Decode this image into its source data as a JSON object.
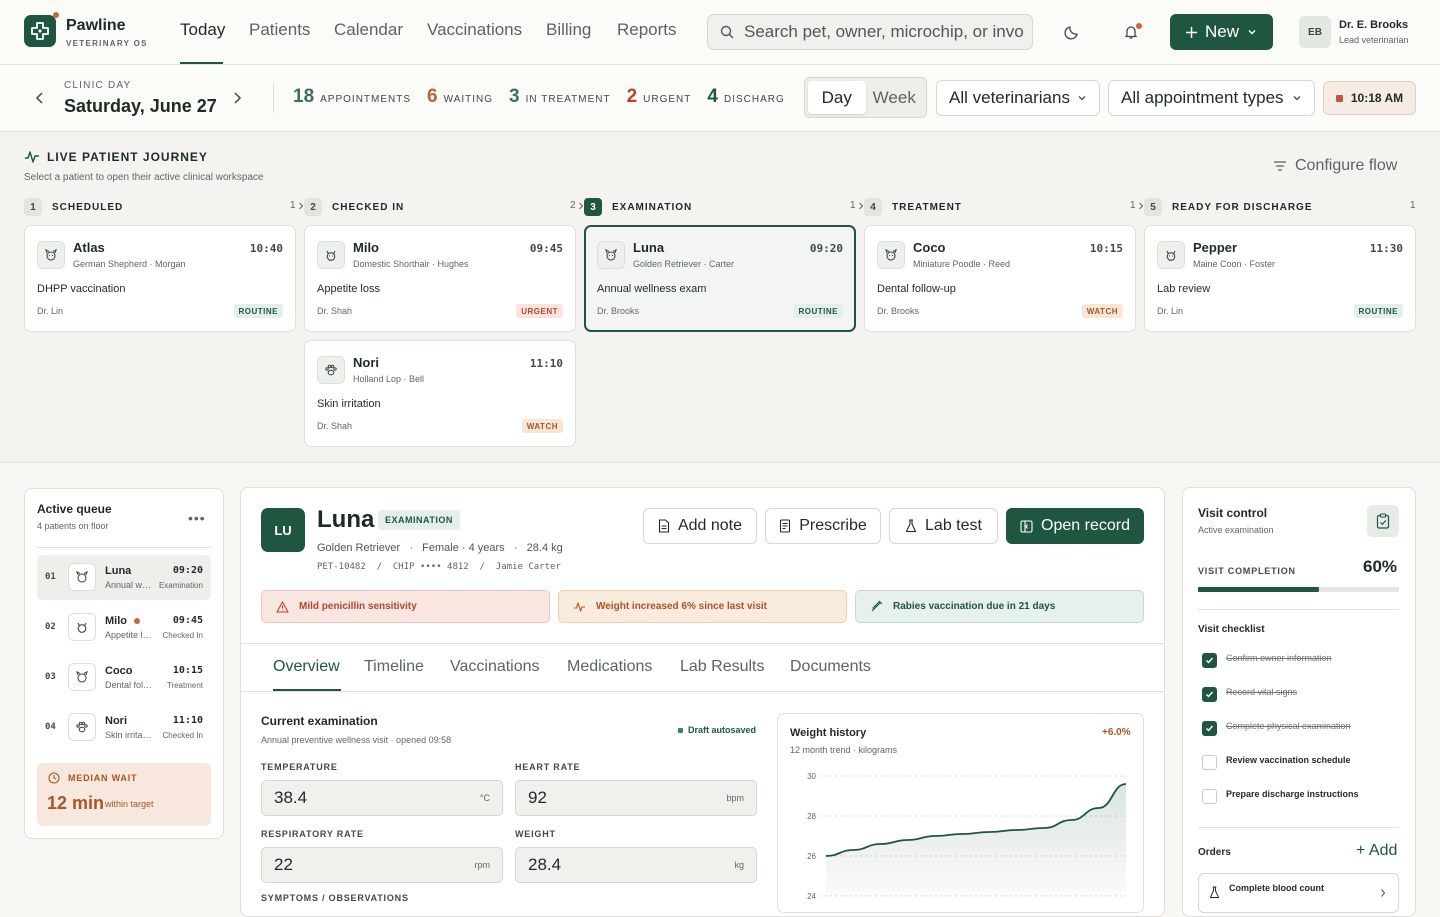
{
  "brand": {
    "name": "Pawline",
    "sub": "VETERINARY OS"
  },
  "nav": [
    {
      "label": "Today"
    },
    {
      "label": "Patients"
    },
    {
      "label": "Calendar"
    },
    {
      "label": "Vaccinations"
    },
    {
      "label": "Billing"
    },
    {
      "label": "Reports"
    }
  ],
  "search": {
    "placeholder": "Search pet, owner, microchip, or invoice"
  },
  "new_button": "New",
  "user": {
    "initials": "EB",
    "name": "Dr. E. Brooks",
    "role": "Lead veterinarian"
  },
  "clinic_day": {
    "label": "CLINIC DAY",
    "date": "Saturday, June 27"
  },
  "stats": [
    {
      "num": "18",
      "label": "APPOINTMENTS",
      "color": "#3f6e5c"
    },
    {
      "num": "6",
      "label": "WAITING",
      "color": "#b9613d"
    },
    {
      "num": "3",
      "label": "IN TREATMENT",
      "color": "#3f6e5c"
    },
    {
      "num": "2",
      "label": "URGENT",
      "color": "#b6452e"
    },
    {
      "num": "4",
      "label": "DISCHARGED",
      "color": "#1f5640"
    }
  ],
  "view_toggle": {
    "day": "Day",
    "week": "Week"
  },
  "filters": {
    "vets": "All veterinarians",
    "types": "All appointment types"
  },
  "clock": "10:18 AM",
  "journey": {
    "title": "LIVE PATIENT JOURNEY",
    "subtitle": "Select a patient to open their active clinical workspace",
    "configure": "Configure flow"
  },
  "columns": [
    {
      "num": "1",
      "name": "SCHEDULED",
      "count": "1"
    },
    {
      "num": "2",
      "name": "CHECKED IN",
      "count": "2"
    },
    {
      "num": "3",
      "name": "EXAMINATION",
      "count": "1"
    },
    {
      "num": "4",
      "name": "TREATMENT",
      "count": "1"
    },
    {
      "num": "5",
      "name": "READY FOR DISCHARGE",
      "count": "1"
    }
  ],
  "cards": [
    {
      "name": "Atlas",
      "breed": "German Shepherd · Morgan",
      "time": "10:40",
      "reason": "DHPP vaccination",
      "vet": "Dr. Lin",
      "badge": "ROUTINE",
      "icon": "dog-icon"
    },
    {
      "name": "Milo",
      "breed": "Domestic Shorthair · Hughes",
      "time": "09:45",
      "reason": "Appetite loss",
      "vet": "Dr. Shah",
      "badge": "URGENT",
      "icon": "cat-icon"
    },
    {
      "name": "Nori",
      "breed": "Holland Lop · Bell",
      "time": "11:10",
      "reason": "Skin irritation",
      "vet": "Dr. Shah",
      "badge": "WATCH",
      "icon": "paw-icon"
    },
    {
      "name": "Luna",
      "breed": "Golden Retriever · Carter",
      "time": "09:20",
      "reason": "Annual wellness exam",
      "vet": "Dr. Brooks",
      "badge": "ROUTINE",
      "icon": "dog-icon"
    },
    {
      "name": "Coco",
      "breed": "Miniature Poodle · Reed",
      "time": "10:15",
      "reason": "Dental follow-up",
      "vet": "Dr. Brooks",
      "badge": "WATCH",
      "icon": "dog-icon"
    },
    {
      "name": "Pepper",
      "breed": "Maine Coon · Foster",
      "time": "11:30",
      "reason": "Lab review",
      "vet": "Dr. Lin",
      "badge": "ROUTINE",
      "icon": "cat-icon"
    }
  ],
  "queue": {
    "title": "Active queue",
    "subtitle": "4 patients on floor",
    "rows": [
      {
        "num": "01",
        "name": "Luna",
        "reason": "Annual wellness exam",
        "time": "09:20",
        "status": "Examination"
      },
      {
        "num": "02",
        "name": "Milo",
        "reason": "Appetite loss",
        "time": "09:45",
        "status": "Checked In"
      },
      {
        "num": "03",
        "name": "Coco",
        "reason": "Dental follow-up",
        "time": "10:15",
        "status": "Treatment"
      },
      {
        "num": "04",
        "name": "Nori",
        "reason": "Skin irritation",
        "time": "11:10",
        "status": "Checked In"
      }
    ],
    "wait": {
      "label": "MEDIAN WAIT",
      "value": "12 min",
      "note": "within target"
    }
  },
  "patient": {
    "initials": "LU",
    "name": "Luna",
    "stage": "EXAMINATION",
    "meta": "Golden Retriever   ·   Female · 4 years   ·   28.4 kg",
    "ids": "PET-10482  /  CHIP •••• 4812  /  Jamie Carter"
  },
  "actions": {
    "note": "Add note",
    "prescribe": "Prescribe",
    "lab": "Lab test",
    "open": "Open record"
  },
  "alerts": {
    "allergy": "Mild penicillin sensitivity",
    "weight": "Weight increased 6% since last visit",
    "vaccine": "Rabies vaccination due in 21 days"
  },
  "tabs": [
    "Overview",
    "Timeline",
    "Vaccinations",
    "Medications",
    "Lab Results",
    "Documents"
  ],
  "exam": {
    "title": "Current examination",
    "subtitle": "Annual preventive wellness visit · opened 09:58",
    "draft": "Draft autosaved",
    "fields": [
      {
        "label": "TEMPERATURE",
        "value": "38.4",
        "unit": "°C"
      },
      {
        "label": "HEART RATE",
        "value": "92",
        "unit": "bpm"
      },
      {
        "label": "RESPIRATORY RATE",
        "value": "22",
        "unit": "rpm"
      },
      {
        "label": "WEIGHT",
        "value": "28.4",
        "unit": "kg"
      }
    ],
    "next_section": "SYMPTOMS / OBSERVATIONS"
  },
  "chart_data": {
    "type": "area",
    "title": "Weight history",
    "subtitle": "12 month trend · kilograms",
    "delta": "+6.0%",
    "ylim": [
      24,
      30
    ],
    "yticks": [
      "30",
      "28",
      "26",
      "24"
    ],
    "series": [
      {
        "values": [
          26.0,
          26.3,
          26.6,
          26.8,
          27.0,
          27.1,
          27.2,
          27.3,
          27.4,
          27.8,
          28.4,
          29.6
        ]
      }
    ]
  },
  "visit": {
    "title": "Visit control",
    "subtitle": "Active examination",
    "completion_label": "VISIT COMPLETION",
    "completion": "60%",
    "completion_value": 0.6,
    "checklist_title": "Visit checklist",
    "checklist": [
      {
        "label": "Confirm owner information",
        "done": true
      },
      {
        "label": "Record vital signs",
        "done": true
      },
      {
        "label": "Complete physical examination",
        "done": true
      },
      {
        "label": "Review vaccination schedule",
        "done": false
      },
      {
        "label": "Prepare discharge instructions",
        "done": false
      }
    ],
    "orders_title": "Orders",
    "add": "+ Add",
    "order": "Complete blood count"
  }
}
